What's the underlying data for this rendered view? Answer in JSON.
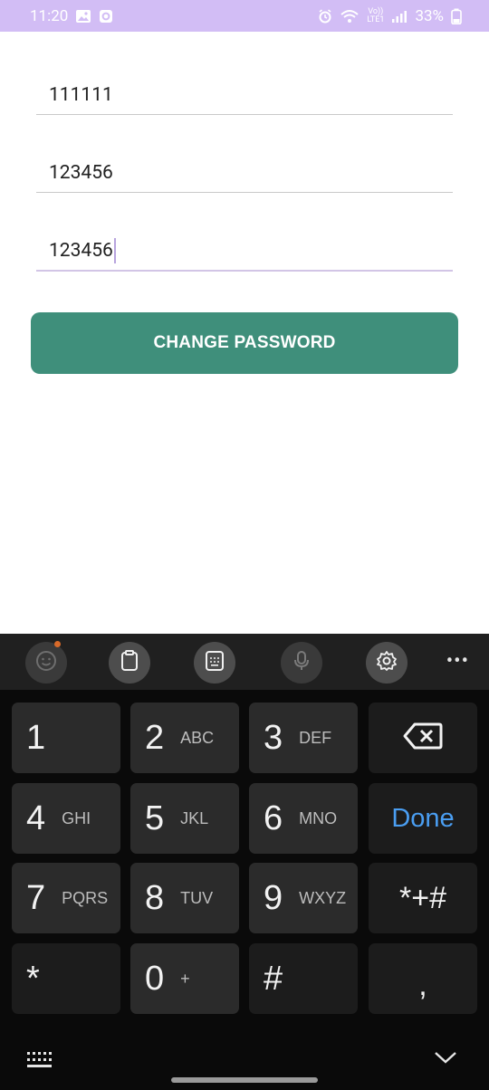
{
  "status_bar": {
    "time": "11:20",
    "volte_label_top": "Vo))",
    "volte_label_bottom": "LTE1",
    "battery": "33%"
  },
  "form": {
    "current_password_value": "111111",
    "new_password_value": "123456",
    "confirm_password_value": "123456",
    "submit_label": "CHANGE PASSWORD"
  },
  "keyboard": {
    "rows": [
      [
        {
          "num": "1",
          "letters": ""
        },
        {
          "num": "2",
          "letters": "ABC"
        },
        {
          "num": "3",
          "letters": "DEF"
        }
      ],
      [
        {
          "num": "4",
          "letters": "GHI"
        },
        {
          "num": "5",
          "letters": "JKL"
        },
        {
          "num": "6",
          "letters": "MNO"
        }
      ],
      [
        {
          "num": "7",
          "letters": "PQRS"
        },
        {
          "num": "8",
          "letters": "TUV"
        },
        {
          "num": "9",
          "letters": "WXYZ"
        }
      ],
      [
        {
          "num": "*",
          "letters": ""
        },
        {
          "num": "0",
          "letters": "+"
        },
        {
          "num": "#",
          "letters": ""
        }
      ]
    ],
    "done_label": "Done",
    "symbols_label": "*+#",
    "comma_label": ",",
    "more_label": "•••",
    "accent_color": "#4a9ef2"
  }
}
